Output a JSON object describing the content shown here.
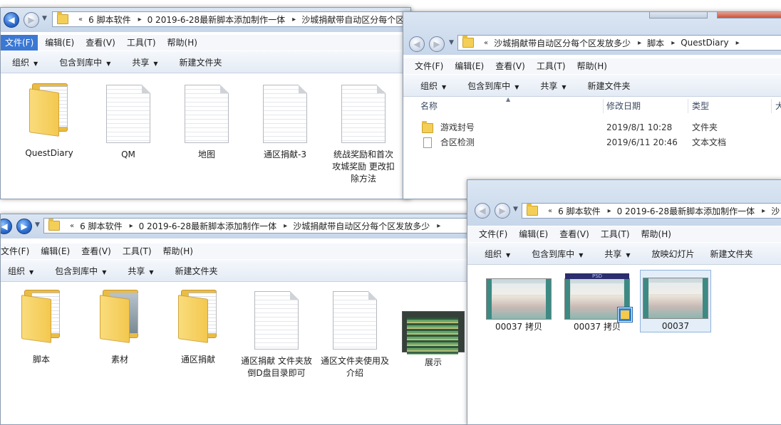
{
  "window1": {
    "crumbs": [
      "6 脚本软件",
      "0 2019-6-28最新脚本添加制作一体",
      "沙城捐献带自动区分每个区发"
    ],
    "menu": [
      "文件(F)",
      "编辑(E)",
      "查看(V)",
      "工具(T)",
      "帮助(H)"
    ],
    "toolbar": [
      "组织",
      "包含到库中",
      "共享",
      "新建文件夹"
    ],
    "items": [
      {
        "label": "QuestDiary",
        "icon": "folder-icon"
      },
      {
        "label": "QM",
        "icon": "text-document-icon"
      },
      {
        "label": "地图",
        "icon": "text-document-icon"
      },
      {
        "label": "通区捐献-3",
        "icon": "text-document-icon"
      },
      {
        "label": "统战奖励和首次攻城奖励 更改扣除方法",
        "icon": "text-document-icon"
      }
    ]
  },
  "window2": {
    "crumbs": [
      "沙城捐献带自动区分每个区发放多少",
      "脚本",
      "QuestDiary"
    ],
    "menu": [
      "文件(F)",
      "编辑(E)",
      "查看(V)",
      "工具(T)",
      "帮助(H)"
    ],
    "toolbar": [
      "组织",
      "包含到库中",
      "共享",
      "新建文件夹"
    ],
    "columns": [
      "名称",
      "修改日期",
      "类型",
      "大"
    ],
    "rows": [
      {
        "name": "游戏封号",
        "date": "2019/8/1 10:28",
        "type": "文件夹",
        "icon": "folder-icon"
      },
      {
        "name": "合区检测",
        "date": "2019/6/11 20:46",
        "type": "文本文档",
        "icon": "text-document-icon"
      }
    ]
  },
  "window3": {
    "crumbs": [
      "6 脚本软件",
      "0 2019-6-28最新脚本添加制作一体",
      "沙城捐献带自动区分每个区发放多少"
    ],
    "menu": [
      "文件(F)",
      "编辑(E)",
      "查看(V)",
      "工具(T)",
      "帮助(H)"
    ],
    "toolbar": [
      "组织",
      "包含到库中",
      "共享",
      "新建文件夹"
    ],
    "items": [
      {
        "label": "脚本",
        "icon": "folder-icon"
      },
      {
        "label": "素材",
        "icon": "folder-icon"
      },
      {
        "label": "通区捐献",
        "icon": "folder-icon"
      },
      {
        "label": "通区捐献   文件夹放倒D盘目录即可",
        "icon": "text-document-icon"
      },
      {
        "label": "通区文件夹使用及介绍",
        "icon": "text-document-icon"
      },
      {
        "label": "展示",
        "icon": "image-thumbnail-icon"
      }
    ]
  },
  "window4": {
    "crumbs": [
      "6 脚本软件",
      "0 2019-6-28最新脚本添加制作一体",
      "沙"
    ],
    "menu": [
      "文件(F)",
      "编辑(E)",
      "查看(V)",
      "工具(T)",
      "帮助(H)"
    ],
    "toolbar": [
      "组织",
      "包含到库中",
      "共享",
      "放映幻灯片",
      "新建文件夹"
    ],
    "items": [
      {
        "label": "00037 拷贝",
        "icon": "image-thumbnail-icon"
      },
      {
        "label": "00037 拷贝",
        "icon": "psd-thumbnail-icon",
        "badge": "PSD"
      },
      {
        "label": "00037",
        "icon": "image-thumbnail-icon",
        "selected": true
      }
    ]
  },
  "colors": {
    "menu_highlight": "#3a78d4",
    "toolbar_bg": "#e9eff7",
    "addr_bg": "#cfdcec"
  }
}
